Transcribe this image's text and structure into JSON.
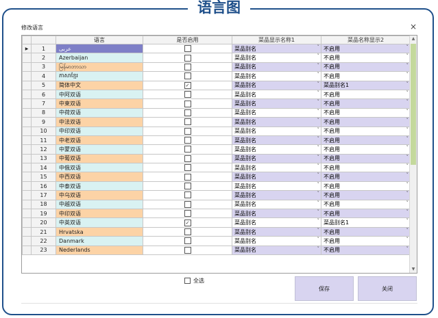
{
  "banner_title": "语言图",
  "dialog": {
    "title": "修改语言",
    "close_icon": "×"
  },
  "columns": {
    "select": "",
    "num": "",
    "language": "语言",
    "enabled": "是否启用",
    "name1": "菜品显示名称1",
    "name2": "菜品名称显示2"
  },
  "rows": [
    {
      "num": "1",
      "language": "عربى",
      "enabled": false,
      "name1": "菜品别名",
      "name2": "不启用",
      "selected": true
    },
    {
      "num": "2",
      "language": "Azerbaijan",
      "enabled": false,
      "name1": "菜品别名",
      "name2": "不启用"
    },
    {
      "num": "3",
      "language": "မြန်မာဘာသာ",
      "enabled": false,
      "name1": "菜品别名",
      "name2": "不启用"
    },
    {
      "num": "4",
      "language": "ភាសាខ្មែរ",
      "enabled": false,
      "name1": "菜品别名",
      "name2": "不启用"
    },
    {
      "num": "5",
      "language": "简体中文",
      "enabled": true,
      "name1": "菜品别名",
      "name2": "菜品别名1"
    },
    {
      "num": "6",
      "language": "中阿双语",
      "enabled": false,
      "name1": "菜品别名",
      "name2": "不启用"
    },
    {
      "num": "7",
      "language": "中柬双语",
      "enabled": false,
      "name1": "菜品别名",
      "name2": "不启用"
    },
    {
      "num": "8",
      "language": "中荷双语",
      "enabled": false,
      "name1": "菜品别名",
      "name2": "不启用"
    },
    {
      "num": "9",
      "language": "中法双语",
      "enabled": false,
      "name1": "菜品别名",
      "name2": "不启用"
    },
    {
      "num": "10",
      "language": "中印双语",
      "enabled": false,
      "name1": "菜品别名",
      "name2": "不启用"
    },
    {
      "num": "11",
      "language": "中老双语",
      "enabled": false,
      "name1": "菜品别名",
      "name2": "不启用"
    },
    {
      "num": "12",
      "language": "中蒙双语",
      "enabled": false,
      "name1": "菜品别名",
      "name2": "不启用"
    },
    {
      "num": "13",
      "language": "中葡双语",
      "enabled": false,
      "name1": "菜品别名",
      "name2": "不启用"
    },
    {
      "num": "14",
      "language": "中俄双语",
      "enabled": false,
      "name1": "菜品别名",
      "name2": "不启用"
    },
    {
      "num": "15",
      "language": "中西双语",
      "enabled": false,
      "name1": "菜品别名",
      "name2": "不启用"
    },
    {
      "num": "16",
      "language": "中泰双语",
      "enabled": false,
      "name1": "菜品别名",
      "name2": "不启用"
    },
    {
      "num": "17",
      "language": "中乌双语",
      "enabled": false,
      "name1": "菜品别名",
      "name2": "不启用"
    },
    {
      "num": "18",
      "language": "中越双语",
      "enabled": false,
      "name1": "菜品别名",
      "name2": "不启用"
    },
    {
      "num": "19",
      "language": "中印双语",
      "enabled": false,
      "name1": "菜品别名",
      "name2": "不启用"
    },
    {
      "num": "20",
      "language": "中英双语",
      "enabled": true,
      "name1": "菜品别名",
      "name2": "菜品别名1"
    },
    {
      "num": "21",
      "language": "Hrvatska",
      "enabled": false,
      "name1": "菜品别名",
      "name2": "不启用"
    },
    {
      "num": "22",
      "language": "Danmark",
      "enabled": false,
      "name1": "菜品别名",
      "name2": "不启用"
    },
    {
      "num": "23",
      "language": "Nederlands",
      "enabled": false,
      "name1": "菜品别名",
      "name2": "不启用"
    }
  ],
  "select_all_label": "全选",
  "save_label": "保存",
  "close_label": "关闭",
  "colors": {
    "frame": "#1e4f8a",
    "lang_orange": "#fcd3a6",
    "lang_cyan": "#d9f2f2",
    "lang_selected": "#7e7fc7",
    "combo_purple": "#d8d4f0",
    "scroll_thumb": "#c4d99c"
  }
}
